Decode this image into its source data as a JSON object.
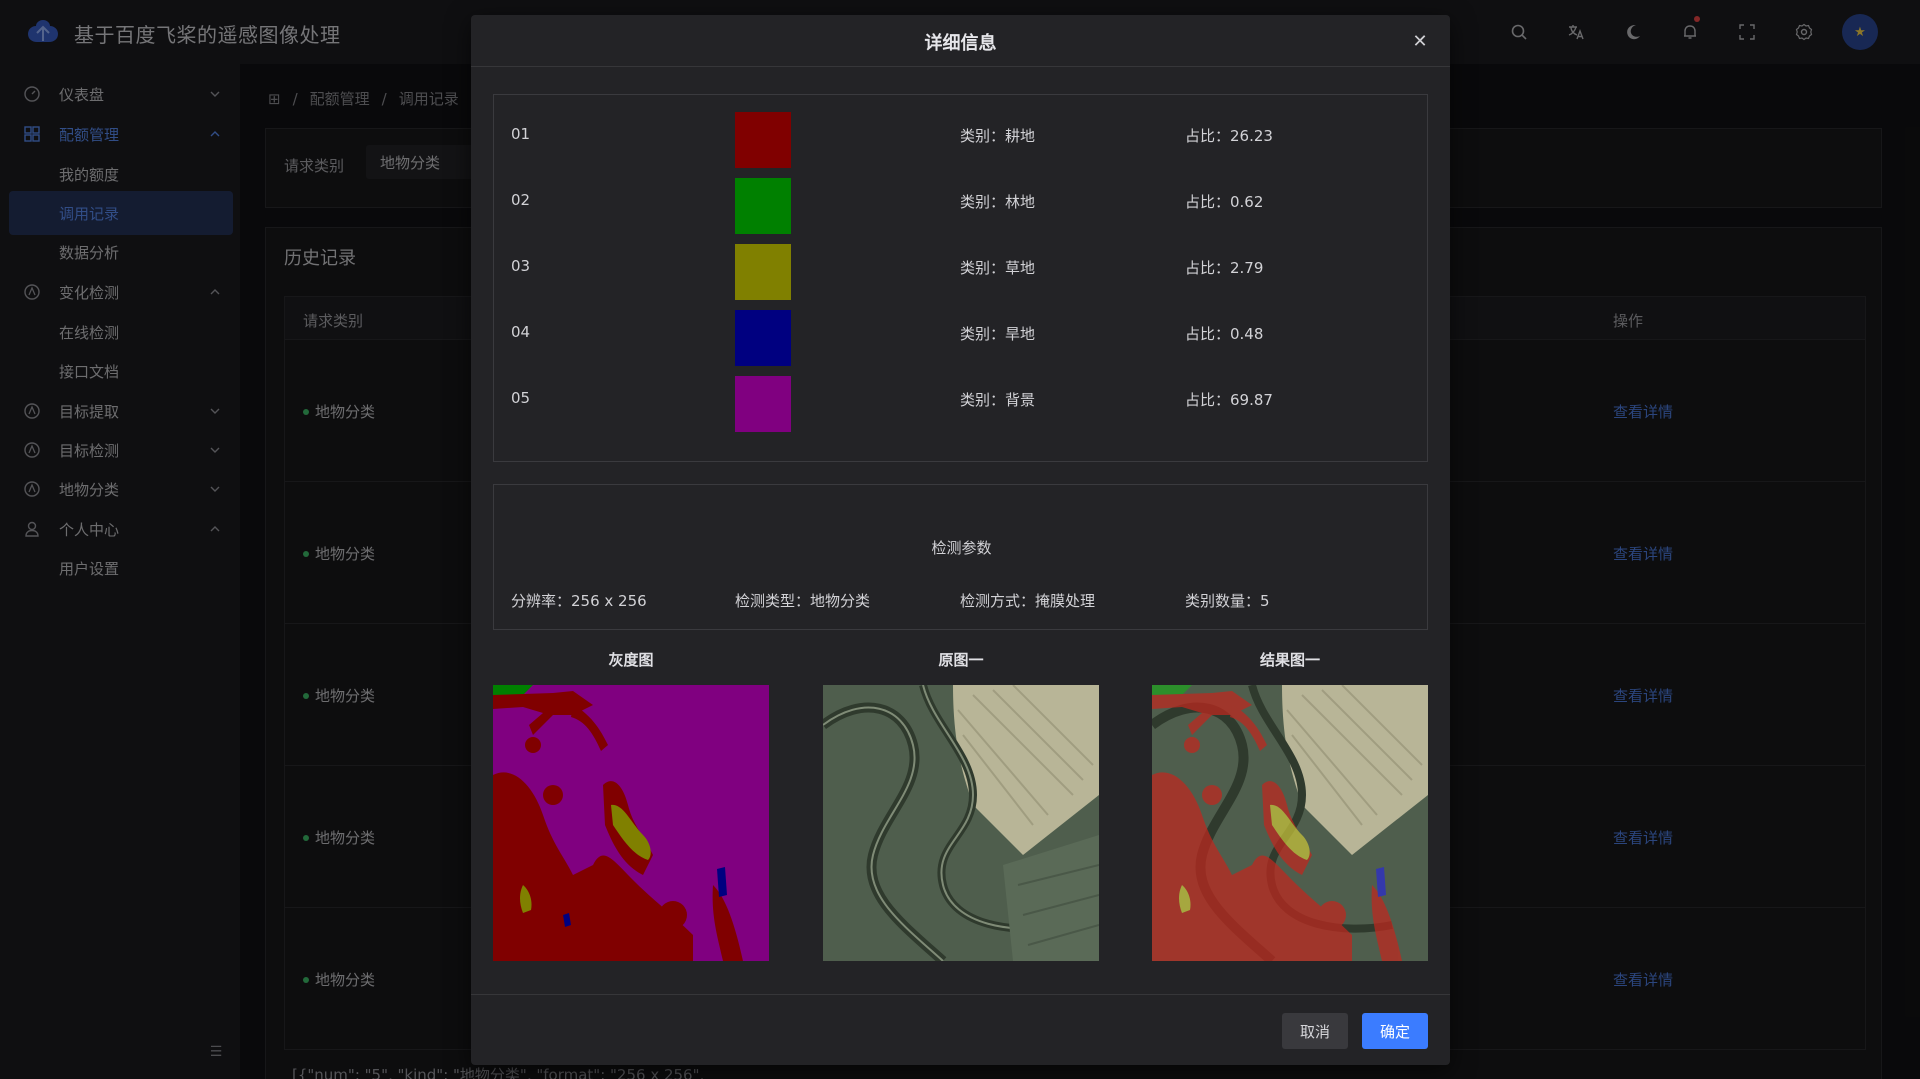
{
  "app": {
    "title": "基于百度飞桨的遥感图像处理"
  },
  "sidebar": {
    "items": [
      {
        "label": "仪表盘"
      },
      {
        "label": "配额管理"
      },
      {
        "label": "我的额度"
      },
      {
        "label": "调用记录"
      },
      {
        "label": "数据分析"
      },
      {
        "label": "变化检测"
      },
      {
        "label": "在线检测"
      },
      {
        "label": "接口文档"
      },
      {
        "label": "目标提取"
      },
      {
        "label": "目标检测"
      },
      {
        "label": "地物分类"
      },
      {
        "label": "个人中心"
      },
      {
        "label": "用户设置"
      }
    ]
  },
  "breadcrumb": {
    "items": [
      "配额管理",
      "调用记录"
    ],
    "sep": "/"
  },
  "filter": {
    "label": "请求类别",
    "value": "地物分类"
  },
  "history": {
    "title": "历史记录",
    "columns": {
      "type": "请求类别",
      "action": "操作"
    },
    "rows": [
      {
        "type": "地物分类",
        "action": "查看详情"
      },
      {
        "type": "地物分类",
        "action": "查看详情"
      },
      {
        "type": "地物分类",
        "action": "查看详情"
      },
      {
        "type": "地物分类",
        "action": "查看详情"
      },
      {
        "type": "地物分类",
        "action": "查看详情"
      }
    ],
    "json_peek": "[{\"num\": \"5\", \"kind\": \"地物分类\", \"format\": \"256 x 256\","
  },
  "modal": {
    "title": "详细信息",
    "legend": [
      {
        "num": "01",
        "kind": "类别：耕地",
        "ratio": "占比：26.23",
        "color": "#800000"
      },
      {
        "num": "02",
        "kind": "类别：林地",
        "ratio": "占比：0.62",
        "color": "#008000"
      },
      {
        "num": "03",
        "kind": "类别：草地",
        "ratio": "占比：2.79",
        "color": "#808000"
      },
      {
        "num": "04",
        "kind": "类别：旱地",
        "ratio": "占比：0.48",
        "color": "#000080"
      },
      {
        "num": "05",
        "kind": "类别：背景",
        "ratio": "占比：69.87",
        "color": "#800080"
      }
    ],
    "params": {
      "title": "检测参数",
      "resolution": "分辨率：256 x 256",
      "type": "检测类型：地物分类",
      "method": "检测方式：掩膜处理",
      "count": "类别数量：5"
    },
    "images": {
      "gray": "灰度图",
      "original": "原图一",
      "result": "结果图一"
    },
    "buttons": {
      "cancel": "取消",
      "ok": "确定"
    }
  },
  "colors": {
    "accent": "#3b7cff",
    "link": "#4f7fe3",
    "status_dot": "#3fbf6a"
  },
  "icons": [
    "search-icon",
    "translate-icon",
    "moon-icon",
    "bell-icon",
    "fullscreen-icon",
    "gear-icon"
  ]
}
